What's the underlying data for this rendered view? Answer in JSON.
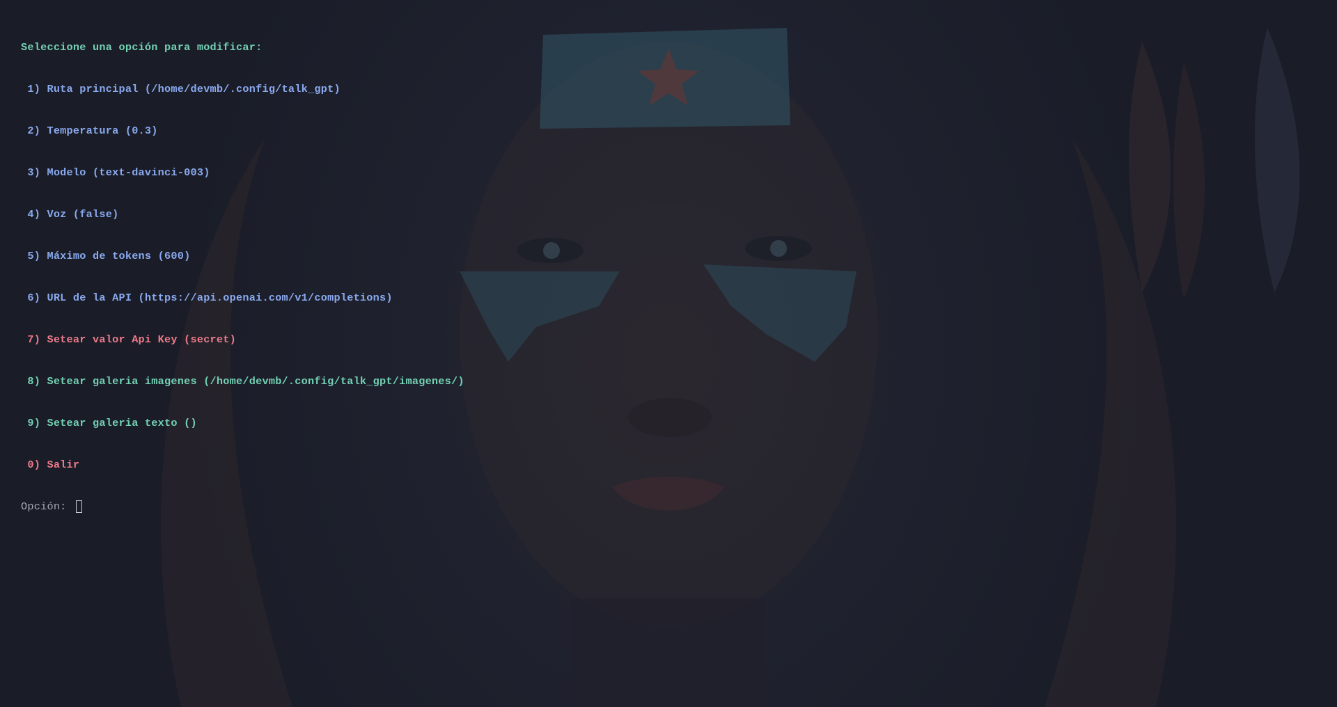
{
  "terminal": {
    "header": "Seleccione una opción para modificar:",
    "options": [
      {
        "label": " 1) Ruta principal (/home/devmb/.config/talk_gpt)",
        "color": "#8aa9ee"
      },
      {
        "label": " 2) Temperatura (0.3)",
        "color": "#8aa9ee"
      },
      {
        "label": " 3) Modelo (text-davinci-003)",
        "color": "#8aa9ee"
      },
      {
        "label": " 4) Voz (false)",
        "color": "#8aa9ee"
      },
      {
        "label": " 5) Máximo de tokens (600)",
        "color": "#8aa9ee"
      },
      {
        "label": " 6) URL de la API (https://api.openai.com/v1/completions)",
        "color": "#8aa9ee"
      },
      {
        "label": " 7) Setear valor Api Key (secret)",
        "color": "#ef7a8a"
      },
      {
        "label": " 8) Setear galeria imagenes (/home/devmb/.config/talk_gpt/imagenes/)",
        "color": "#74d1b4"
      },
      {
        "label": " 9) Setear galeria texto ()",
        "color": "#74d1b4"
      },
      {
        "label": " 0) Salir",
        "color": "#ef7a8a"
      }
    ],
    "prompt": "Opción:",
    "input_value": ""
  },
  "theme": {
    "background": "#1c1f2b",
    "header_color": "#74d1b4",
    "prompt_color": "#a8abb8"
  }
}
